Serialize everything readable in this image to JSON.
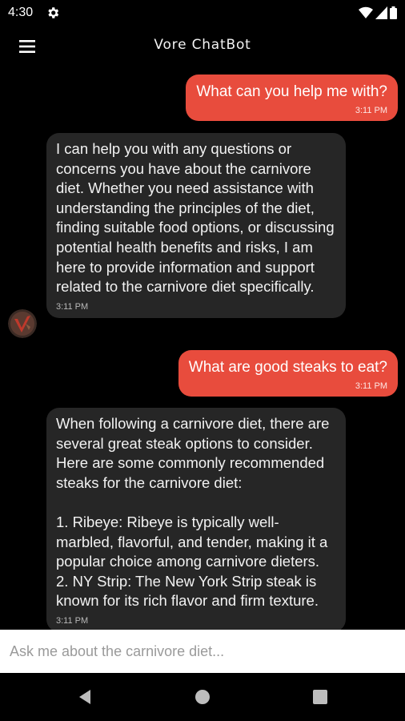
{
  "status_bar": {
    "time": "4:30"
  },
  "app_bar": {
    "title": "Vore ChatBot"
  },
  "messages": [
    {
      "sender": "user",
      "text": "What can you help me with?",
      "time": "3:11 PM"
    },
    {
      "sender": "bot",
      "text": "I can help you with any questions or concerns you have about the carnivore diet. Whether you need assistance with understanding the principles of the diet, finding suitable food options, or discussing potential health benefits and risks, I am here to provide information and support related to the carnivore diet specifically.",
      "time": "3:11 PM"
    },
    {
      "sender": "user",
      "text": "What are good steaks to eat?",
      "time": "3:11 PM"
    },
    {
      "sender": "bot",
      "text": "When following a carnivore diet, there are several great steak options to consider. Here are some commonly recommended steaks for the carnivore diet:\n\n1. Ribeye: Ribeye is typically well-marbled, flavorful, and tender, making it a popular choice among carnivore dieters.\n2. NY Strip: The New York Strip steak is known for its rich flavor and firm texture.",
      "time": "3:11 PM"
    }
  ],
  "input": {
    "placeholder": "Ask me about the carnivore diet..."
  },
  "colors": {
    "user_bubble": "#e84c3d",
    "bot_bubble": "#262626",
    "background": "#000000"
  }
}
